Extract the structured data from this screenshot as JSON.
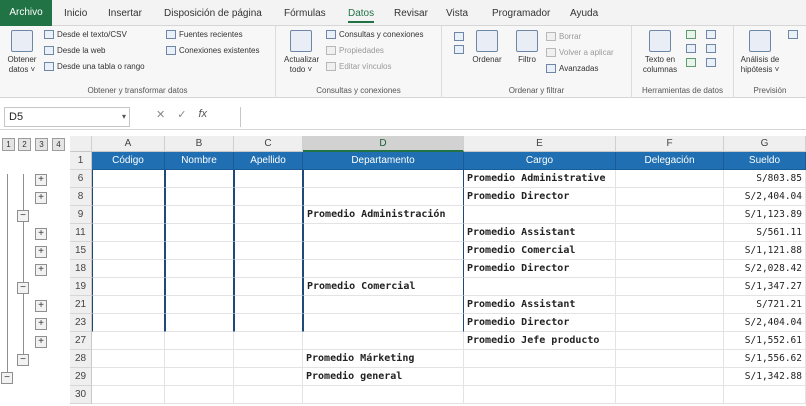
{
  "tabs": [
    "Archivo",
    "Inicio",
    "Insertar",
    "Disposición de página",
    "Fórmulas",
    "Datos",
    "Revisar",
    "Vista",
    "Programador",
    "Ayuda"
  ],
  "active_tab": "Datos",
  "ribbon": {
    "g1": {
      "label": "Obtener y transformar datos",
      "big": "Obtener datos ˅",
      "items": [
        "Desde el texto/CSV",
        "Desde la web",
        "Desde una tabla o rango",
        "Fuentes recientes",
        "Conexiones existentes"
      ]
    },
    "g2": {
      "label": "Consultas y conexiones",
      "big": "Actualizar todo ˅",
      "items": [
        "Consultas y conexiones",
        "Propiedades",
        "Editar vínculos"
      ]
    },
    "g3": {
      "label": "Ordenar y filtrar",
      "ordenar": "Ordenar",
      "filtro": "Filtro",
      "items": [
        "Borrar",
        "Volver a aplicar",
        "Avanzadas"
      ]
    },
    "g4": {
      "label": "Herramientas de datos",
      "big": "Texto en columnas"
    },
    "g5": {
      "label": "Previsión",
      "big": "Análisis de hipótesis ˅"
    }
  },
  "namebox": "D5",
  "fx_symbols": {
    "cancel": "✕",
    "enter": "✓",
    "fx": "fx"
  },
  "outline": {
    "levels": [
      "1",
      "2",
      "3",
      "4"
    ],
    "plus": "+",
    "minus": "−"
  },
  "columns": [
    "A",
    "B",
    "C",
    "D",
    "E",
    "F",
    "G"
  ],
  "headers": [
    "Código",
    "Nombre",
    "Apellido",
    "Departamento",
    "Cargo",
    "Delegación",
    "Sueldo"
  ],
  "rows": [
    {
      "num": "6",
      "dept": "",
      "cargo": "Promedio Administrative",
      "sueldo": "S/803.85"
    },
    {
      "num": "8",
      "dept": "",
      "cargo": "Promedio Director",
      "sueldo": "S/2,404.04"
    },
    {
      "num": "9",
      "dept": "Promedio Administración",
      "cargo": "",
      "sueldo": "S/1,123.89"
    },
    {
      "num": "11",
      "dept": "",
      "cargo": "Promedio Assistant",
      "sueldo": "S/561.11"
    },
    {
      "num": "15",
      "dept": "",
      "cargo": "Promedio Comercial",
      "sueldo": "S/1,121.88"
    },
    {
      "num": "18",
      "dept": "",
      "cargo": "Promedio Director",
      "sueldo": "S/2,028.42"
    },
    {
      "num": "19",
      "dept": "Promedio Comercial",
      "cargo": "",
      "sueldo": "S/1,347.27"
    },
    {
      "num": "21",
      "dept": "",
      "cargo": "Promedio Assistant",
      "sueldo": "S/721.21"
    },
    {
      "num": "23",
      "dept": "",
      "cargo": "Promedio Director",
      "sueldo": "S/2,404.04"
    },
    {
      "num": "27",
      "dept": "",
      "cargo": "Promedio Jefe producto",
      "sueldo": "S/1,552.61"
    },
    {
      "num": "28",
      "dept": "Promedio Márketing",
      "cargo": "",
      "sueldo": "S/1,556.62"
    },
    {
      "num": "29",
      "dept": "Promedio general",
      "cargo": "",
      "sueldo": "S/1,342.88"
    },
    {
      "num": "30",
      "dept": "",
      "cargo": "",
      "sueldo": ""
    }
  ],
  "colors": {
    "accent": "#217346",
    "header_fill": "#1f6fb2"
  }
}
